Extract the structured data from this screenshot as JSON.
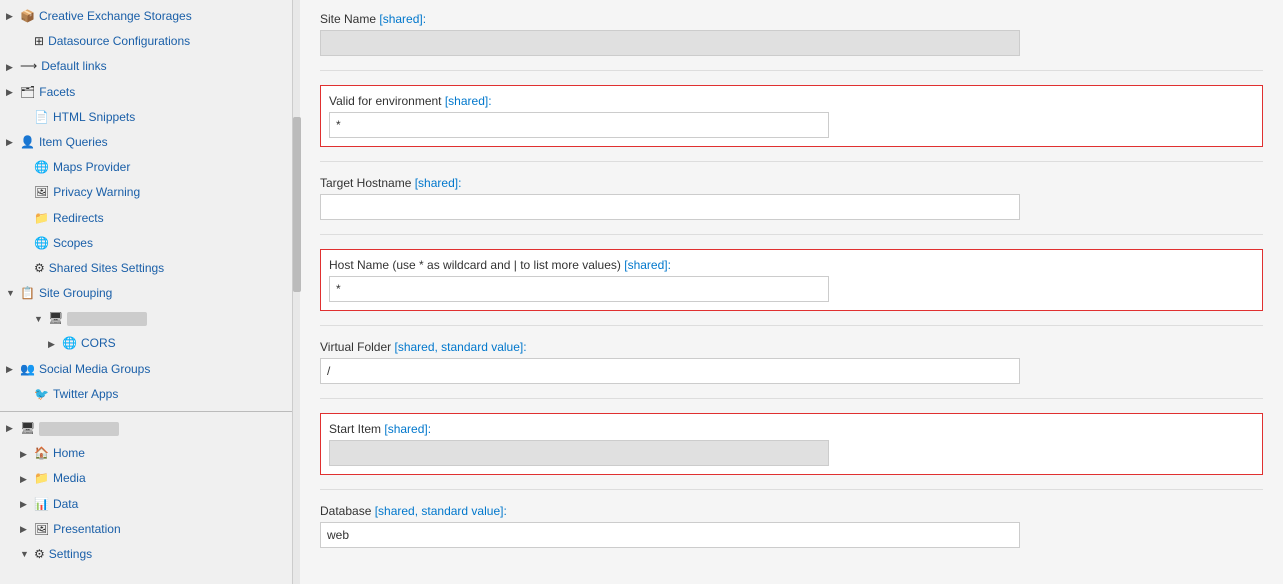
{
  "sidebar": {
    "items": [
      {
        "id": "creative-exchange",
        "label": "Creative Exchange Storages",
        "level": 1,
        "arrow": "▶",
        "icon": "📦",
        "expanded": false
      },
      {
        "id": "datasource-config",
        "label": "Datasource Configurations",
        "level": 2,
        "arrow": "",
        "icon": "⊞",
        "expanded": false
      },
      {
        "id": "default-links",
        "label": "Default links",
        "level": 1,
        "arrow": "▶",
        "icon": "⟶",
        "expanded": false
      },
      {
        "id": "facets",
        "label": "Facets",
        "level": 1,
        "arrow": "▶",
        "icon": "🗂",
        "expanded": false
      },
      {
        "id": "html-snippets",
        "label": "HTML Snippets",
        "level": 2,
        "arrow": "",
        "icon": "📄",
        "expanded": false
      },
      {
        "id": "item-queries",
        "label": "Item Queries",
        "level": 1,
        "arrow": "▶",
        "icon": "👤",
        "expanded": false
      },
      {
        "id": "maps-provider",
        "label": "Maps Provider",
        "level": 2,
        "arrow": "",
        "icon": "🌐",
        "expanded": false
      },
      {
        "id": "privacy-warning",
        "label": "Privacy Warning",
        "level": 2,
        "arrow": "",
        "icon": "🖼",
        "expanded": false
      },
      {
        "id": "redirects",
        "label": "Redirects",
        "level": 2,
        "arrow": "",
        "icon": "📁",
        "expanded": false
      },
      {
        "id": "scopes",
        "label": "Scopes",
        "level": 2,
        "arrow": "",
        "icon": "🌐",
        "expanded": false
      },
      {
        "id": "shared-sites-settings",
        "label": "Shared Sites Settings",
        "level": 2,
        "arrow": "",
        "icon": "⚙",
        "expanded": false
      },
      {
        "id": "site-grouping",
        "label": "Site Grouping",
        "level": 1,
        "arrow": "▼",
        "icon": "📋",
        "expanded": true
      },
      {
        "id": "site-grouping-child",
        "label": "BLURRED",
        "level": 3,
        "arrow": "▼",
        "icon": "🖥",
        "expanded": true,
        "blurred": true
      },
      {
        "id": "cors",
        "label": "CORS",
        "level": 4,
        "arrow": "▶",
        "icon": "🌐",
        "expanded": false
      },
      {
        "id": "social-media-groups",
        "label": "Social Media Groups",
        "level": 1,
        "arrow": "▶",
        "icon": "👥",
        "expanded": false
      },
      {
        "id": "twitter-apps",
        "label": "Twitter Apps",
        "level": 2,
        "arrow": "",
        "icon": "🐦",
        "expanded": false
      }
    ],
    "blurred_section_label": "BLURRED_SECTION"
  },
  "main": {
    "fields": [
      {
        "id": "site-name",
        "label": "Site Name",
        "shared_tag": "[shared]",
        "colon": ":",
        "value_blurred": true,
        "value": "BLURRED",
        "highlighted": false,
        "has_divider": true
      },
      {
        "id": "valid-for-environment",
        "label": "Valid for environment",
        "shared_tag": "[shared]",
        "colon": ":",
        "value": "*",
        "highlighted": true,
        "has_divider": true
      },
      {
        "id": "target-hostname",
        "label": "Target Hostname",
        "shared_tag": "[shared]",
        "colon": ":",
        "value": "",
        "highlighted": false,
        "has_divider": true
      },
      {
        "id": "host-name",
        "label": "Host Name (use * as wildcard and | to list more values)",
        "shared_tag": "[shared]",
        "colon": ":",
        "value": "*",
        "highlighted": true,
        "has_divider": true
      },
      {
        "id": "virtual-folder",
        "label": "Virtual Folder",
        "shared_tag": "[shared, standard value]",
        "colon": ":",
        "value": "/",
        "highlighted": false,
        "has_divider": true
      },
      {
        "id": "start-item",
        "label": "Start Item",
        "shared_tag": "[shared]",
        "colon": ":",
        "value_blurred": true,
        "value": "BLURRED/Home",
        "highlighted": true,
        "has_divider": true
      },
      {
        "id": "database",
        "label": "Database",
        "shared_tag": "[shared, standard value]",
        "colon": ":",
        "value": "web",
        "highlighted": false,
        "has_divider": false
      }
    ]
  },
  "labels": {
    "shared": "[shared]",
    "shared_standard": "[shared, standard value]"
  }
}
